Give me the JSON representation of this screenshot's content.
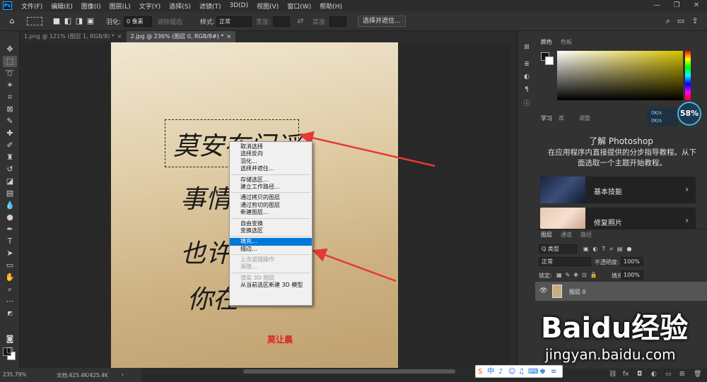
{
  "menubar": {
    "logo": "Ps",
    "items": [
      "文件(F)",
      "编辑(E)",
      "图像(I)",
      "图层(L)",
      "文字(Y)",
      "选择(S)",
      "滤镜(T)",
      "3D(D)",
      "视图(V)",
      "窗口(W)",
      "帮助(H)"
    ],
    "controls": [
      "—",
      "❐",
      "✕"
    ]
  },
  "options": {
    "feather_label": "羽化:",
    "feather_value": "0 像素",
    "antialias_label": "消除锯齿",
    "style_label": "样式:",
    "style_value": "正常",
    "width_label": "宽度:",
    "height_label": "高度:",
    "select_mask_button": "选择并遮住..."
  },
  "tabs": [
    {
      "label": "1.png @ 121% (图层 1, RGB/8) *",
      "close": "×"
    },
    {
      "label": "2.jpg @ 236% (图层 0, RGB/8#) *",
      "close": "×"
    }
  ],
  "document": {
    "handwriting": [
      "莫安布门谣",
      "事情",
      "也许",
      "你在"
    ],
    "seal_text": "莫让晨"
  },
  "context_menu": {
    "groups": [
      [
        "取消选择",
        "选择反向",
        "羽化...",
        "选择并遮住..."
      ],
      [
        "存储选区...",
        "建立工作路径..."
      ],
      [
        "通过拷贝的图层",
        "通过剪切的图层",
        "新建图层..."
      ],
      [
        "自由变换",
        "变换选区"
      ],
      [
        "填充...",
        "描边..."
      ],
      [
        "上次滤镜操作",
        "渐隐..."
      ],
      [
        "渲染 3D 图层",
        "从当前选区新建 3D 模型"
      ]
    ],
    "highlighted": "填充...",
    "disabled": [
      "上次滤镜操作",
      "渐隐...",
      "渲染 3D 图层"
    ]
  },
  "status": {
    "zoom": "235.79%",
    "doc_size": "文档:425.4K/425.4K"
  },
  "panels": {
    "color_tabs": [
      "颜色",
      "色板"
    ],
    "learn_tabs": [
      "学习",
      "库",
      "调整"
    ],
    "learn_title": "了解 Photoshop",
    "learn_desc": "在应用程序内直接提供的分步指导教程。从下面选取一个主题开始教程。",
    "cards": [
      "基本技能",
      "修复照片"
    ],
    "layer_tabs": [
      "图层",
      "通道",
      "路径"
    ],
    "filter_label": "Q 类型",
    "blend_mode": "正常",
    "opacity_label": "不透明度:",
    "opacity_value": "100%",
    "lock_label": "锁定:",
    "fill_label": "填充:",
    "fill_value": "100%",
    "layer_name": "图层 0"
  },
  "overlay": {
    "net_up": "0K/s",
    "net_down": "0K/s",
    "gauge": "58%",
    "ime_label": "中",
    "baidu_logo": "Baidu经验",
    "baidu_url": "jingyan.baidu.com"
  },
  "colors": {
    "accent": "#31a8ff",
    "highlight": "#0078d7",
    "arrow": "#e53935"
  }
}
